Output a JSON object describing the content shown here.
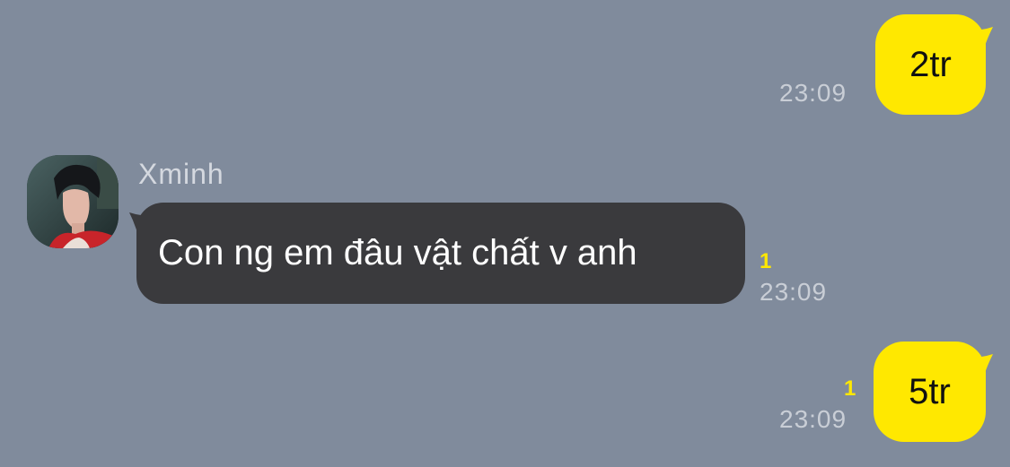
{
  "colors": {
    "background": "#808b9c",
    "outgoing_bubble": "#ffe800",
    "incoming_bubble": "#3a3a3d",
    "unread_count": "#ffe800",
    "timestamp": "#c9ced6"
  },
  "messages": [
    {
      "direction": "outgoing",
      "text": "2tr",
      "time": "23:09",
      "unread": ""
    },
    {
      "direction": "incoming",
      "sender": "Xminh",
      "avatar": "avatar-photo",
      "text": "Con ng em đâu vật chất v anh",
      "time": "23:09",
      "unread": "1"
    },
    {
      "direction": "outgoing",
      "text": "5tr",
      "time": "23:09",
      "unread": "1"
    }
  ]
}
